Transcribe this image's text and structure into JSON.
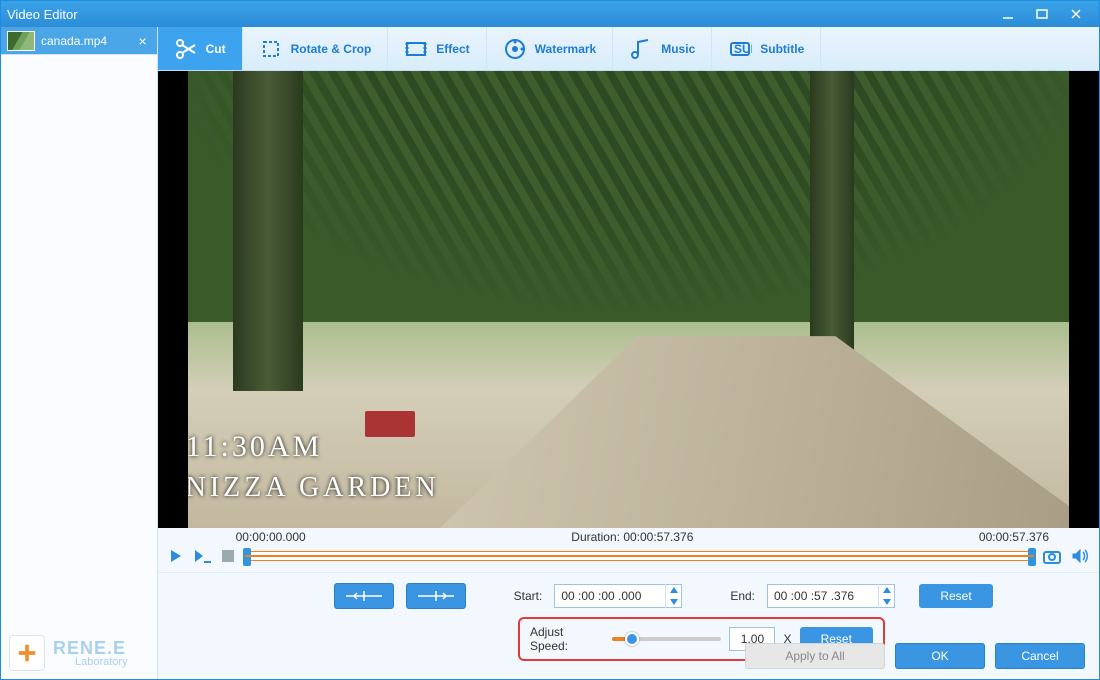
{
  "window": {
    "title": "Video Editor"
  },
  "file": {
    "name": "canada.mp4"
  },
  "toolbar": {
    "cut": "Cut",
    "rotate": "Rotate & Crop",
    "effect": "Effect",
    "watermark": "Watermark",
    "music": "Music",
    "subtitle": "Subtitle"
  },
  "preview": {
    "overlay_time": "11:30AM",
    "overlay_title": "NIZZA GARDEN"
  },
  "timeline": {
    "start": "00:00:00.000",
    "duration_label": "Duration:",
    "duration": "00:00:57.376",
    "end": "00:00:57.376"
  },
  "controls": {
    "start_label": "Start:",
    "start_value": "00 :00 :00 .000",
    "end_label": "End:",
    "end_value": "00 :00 :57 .376",
    "reset": "Reset",
    "speed_label": "Adjust Speed:",
    "speed_value": "1.00",
    "speed_suffix": "X",
    "speed_reset": "Reset"
  },
  "footer": {
    "apply_all": "Apply to All",
    "ok": "OK",
    "cancel": "Cancel"
  },
  "brand": {
    "line1": "RENE.E",
    "line2": "Laboratory"
  }
}
